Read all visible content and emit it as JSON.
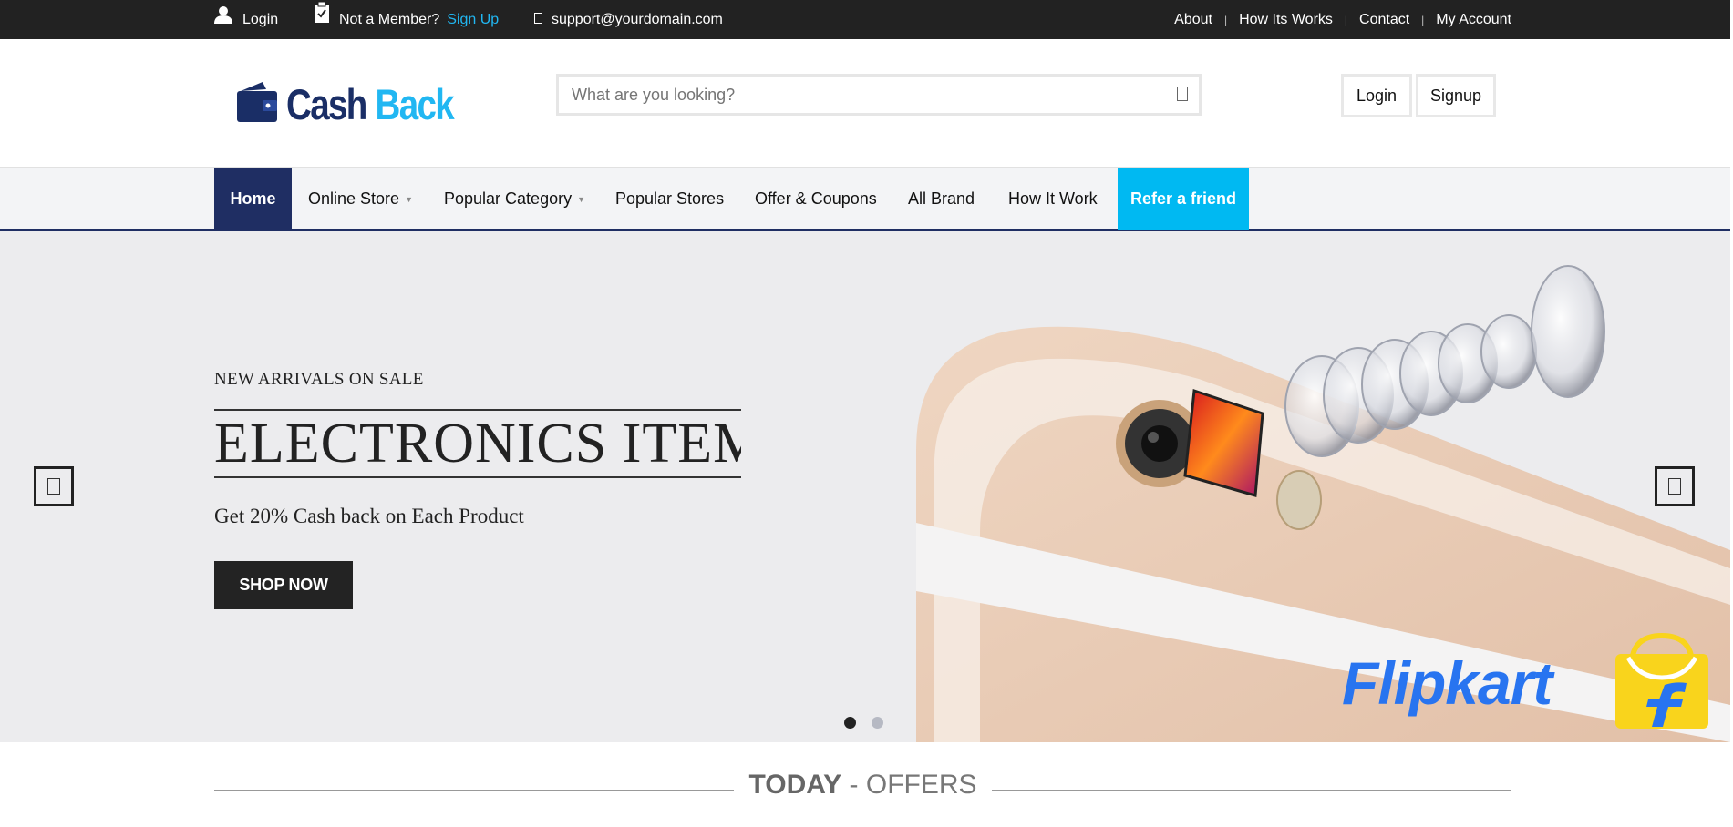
{
  "topbar": {
    "login": "Login",
    "not_member": "Not a Member?",
    "sign_up": "Sign Up",
    "email": "support@yourdomain.com",
    "nav": [
      "About",
      "How Its Works",
      "Contact",
      "My Account"
    ]
  },
  "header": {
    "logo_cash": "Cash",
    "logo_back": "Back",
    "search_placeholder": "What are you looking?",
    "login_button": "Login",
    "signup_button": "Signup"
  },
  "nav": {
    "items": [
      "Home",
      "Online Store",
      "Popular Category",
      "Popular Stores",
      "Offer & Coupons",
      "All Brand",
      "How It Work",
      "Refer a friend"
    ],
    "active": "Home"
  },
  "hero": {
    "subtitle": "NEW ARRIVALS ON SALE",
    "title": "ELECTRONICS ITEMS",
    "offer": "Get 20% Cash back on Each Product",
    "cta": "SHOP NOW",
    "brand": "Flipkart",
    "slide_count": 2,
    "active_slide": 1
  },
  "section": {
    "title_bold": "TODAY",
    "title_sep": " - ",
    "title_light": "OFFERS"
  },
  "colors": {
    "brand_navy": "#1f2e63",
    "accent_blue": "#00b9f2",
    "flipkart_blue": "#2874f0",
    "flipkart_yellow": "#f9d41c"
  }
}
